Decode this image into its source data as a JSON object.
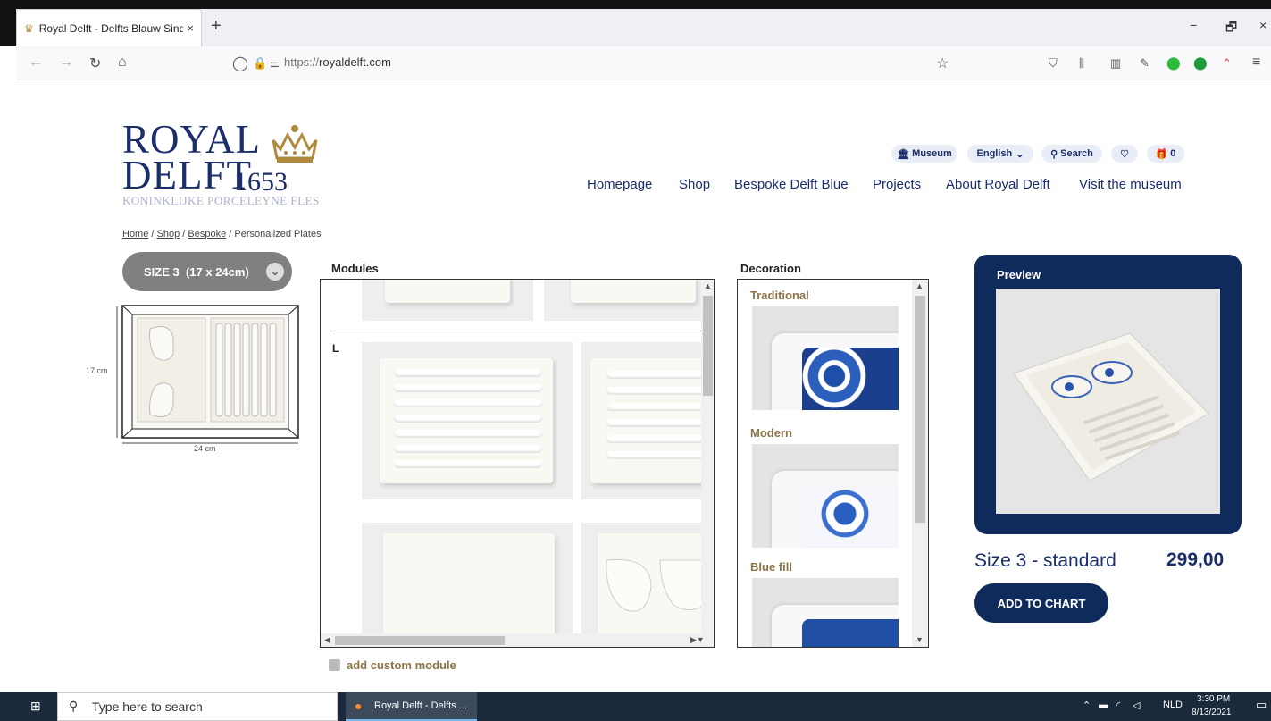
{
  "browser": {
    "tab_title": "Royal Delft - Delfts Blauw Sinds",
    "tab_close": "×",
    "new_tab": "+",
    "url_prefix": "https://",
    "url_domain": "royaldelft.com",
    "window_minimize": "−",
    "window_restore": "🗗",
    "window_close": "×"
  },
  "site": {
    "logo": {
      "line1": "ROYAL",
      "line2": "DELFT",
      "year": "1653",
      "subtitle": "KONINKLIJKE PORCELEYNE FLES"
    },
    "utility": {
      "museum": "Museum",
      "language": "English",
      "search": "Search",
      "cart_count": "0"
    },
    "menu": [
      "Homepage",
      "Shop",
      "Bespoke Delft Blue",
      "Projects",
      "About Royal Delft",
      "Visit the museum"
    ],
    "breadcrumb": {
      "home": "Home",
      "shop": "Shop",
      "bespoke": "Bespoke",
      "current": "Personalized Plates",
      "sep": " / "
    },
    "size_select": "SIZE 3  (17 x 24cm)",
    "dimensions": {
      "height": "17 cm",
      "width": "24 cm"
    },
    "sections": {
      "modules": "Modules",
      "decoration": "Decoration",
      "preview": "Preview"
    },
    "module_group": "L",
    "decorations": [
      "Traditional",
      "Modern",
      "Blue fill"
    ],
    "product": {
      "name": "Size 3 - standard",
      "price": "299,00",
      "add_button": "ADD TO CHART"
    },
    "custom_module": "add custom module"
  },
  "taskbar": {
    "search_placeholder": "Type here to search",
    "app_label": "Royal Delft - Delfts ...",
    "lang": "NLD",
    "time": "3:30 PM",
    "date": "8/13/2021"
  },
  "colors": {
    "navy": "#0f2b5c",
    "brand_blue": "#1b2e6b",
    "gold": "#8a7448"
  }
}
